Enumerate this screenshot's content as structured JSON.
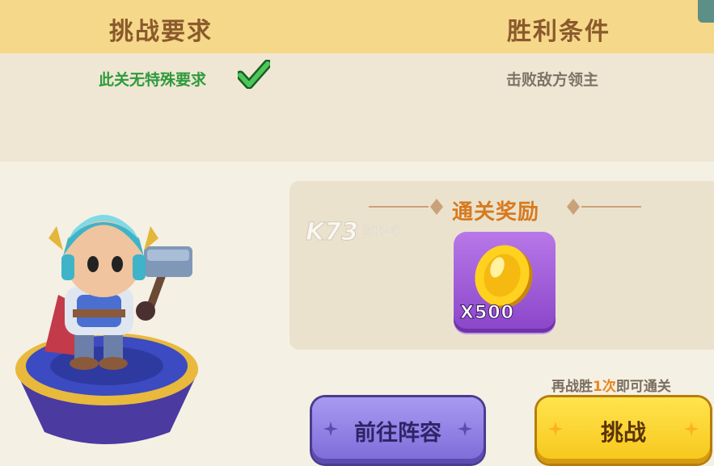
{
  "header": {
    "left_title": "挑战要求",
    "right_title": "胜利条件"
  },
  "requirements": {
    "left_text": "此关无特殊要求",
    "right_text": "击败敌方领主"
  },
  "reward": {
    "title": "通关奖励",
    "item_icon": "gold-coin-icon",
    "item_quantity": "X500"
  },
  "watermark": {
    "brand": "K73",
    "site": "游戏之家"
  },
  "hint": {
    "prefix": "再战胜",
    "count": "1次",
    "suffix": "即可通关"
  },
  "buttons": {
    "lineup_label": "前往阵容",
    "challenge_label": "挑战"
  },
  "colors": {
    "header_bg": "#f6d88a",
    "success_green": "#2f9a3c",
    "reward_orange": "#d77a1f",
    "tile_purple": "#8a45c9",
    "button_purple": "#7d6ad8",
    "button_yellow": "#f7c61a"
  }
}
